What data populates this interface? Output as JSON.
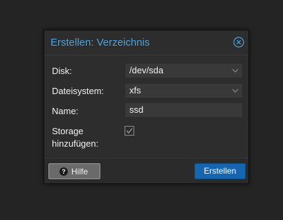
{
  "dialog": {
    "title": "Erstellen: Verzeichnis",
    "close_icon": "close-circle-icon"
  },
  "form": {
    "disk": {
      "label": "Disk:",
      "value": "/dev/sda"
    },
    "filesystem": {
      "label": "Dateisystem:",
      "value": "xfs"
    },
    "name": {
      "label": "Name:",
      "value": "ssd"
    },
    "add_storage": {
      "label_line1": "Storage",
      "label_line2": "hinzufügen:",
      "checked": true
    }
  },
  "footer": {
    "help_label": "Hilfe",
    "help_icon": "question-circle-icon",
    "create_label": "Erstellen"
  },
  "colors": {
    "title": "#4aa3df",
    "primary_button": "#1565b0",
    "background": "#242424",
    "dialog": "#2d2d2d"
  }
}
